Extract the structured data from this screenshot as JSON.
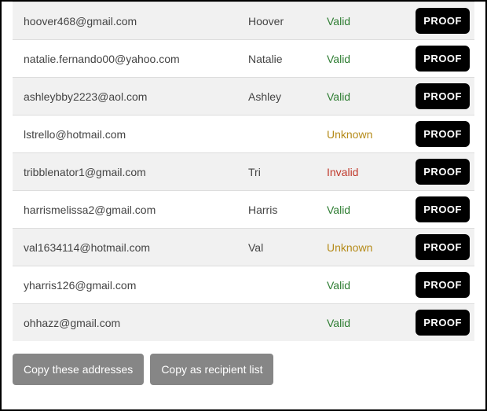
{
  "status_colors": {
    "Valid": "status-valid",
    "Invalid": "status-invalid",
    "Unknown": "status-unknown"
  },
  "rows": [
    {
      "email": "hoover468@gmail.com",
      "name": "Hoover",
      "status": "Valid",
      "action": "PROOF"
    },
    {
      "email": "natalie.fernando00@yahoo.com",
      "name": "Natalie",
      "status": "Valid",
      "action": "PROOF"
    },
    {
      "email": "ashleybby2223@aol.com",
      "name": "Ashley",
      "status": "Valid",
      "action": "PROOF"
    },
    {
      "email": "lstrello@hotmail.com",
      "name": "",
      "status": "Unknown",
      "action": "PROOF"
    },
    {
      "email": "tribblenator1@gmail.com",
      "name": "Tri",
      "status": "Invalid",
      "action": "PROOF"
    },
    {
      "email": "harrismelissa2@gmail.com",
      "name": "Harris",
      "status": "Valid",
      "action": "PROOF"
    },
    {
      "email": "val1634114@hotmail.com",
      "name": "Val",
      "status": "Unknown",
      "action": "PROOF"
    },
    {
      "email": "yharris126@gmail.com",
      "name": "",
      "status": "Valid",
      "action": "PROOF"
    },
    {
      "email": "ohhazz@gmail.com",
      "name": "",
      "status": "Valid",
      "action": "PROOF"
    }
  ],
  "footer": {
    "copy_addresses": "Copy these addresses",
    "copy_recipients": "Copy as recipient list"
  }
}
